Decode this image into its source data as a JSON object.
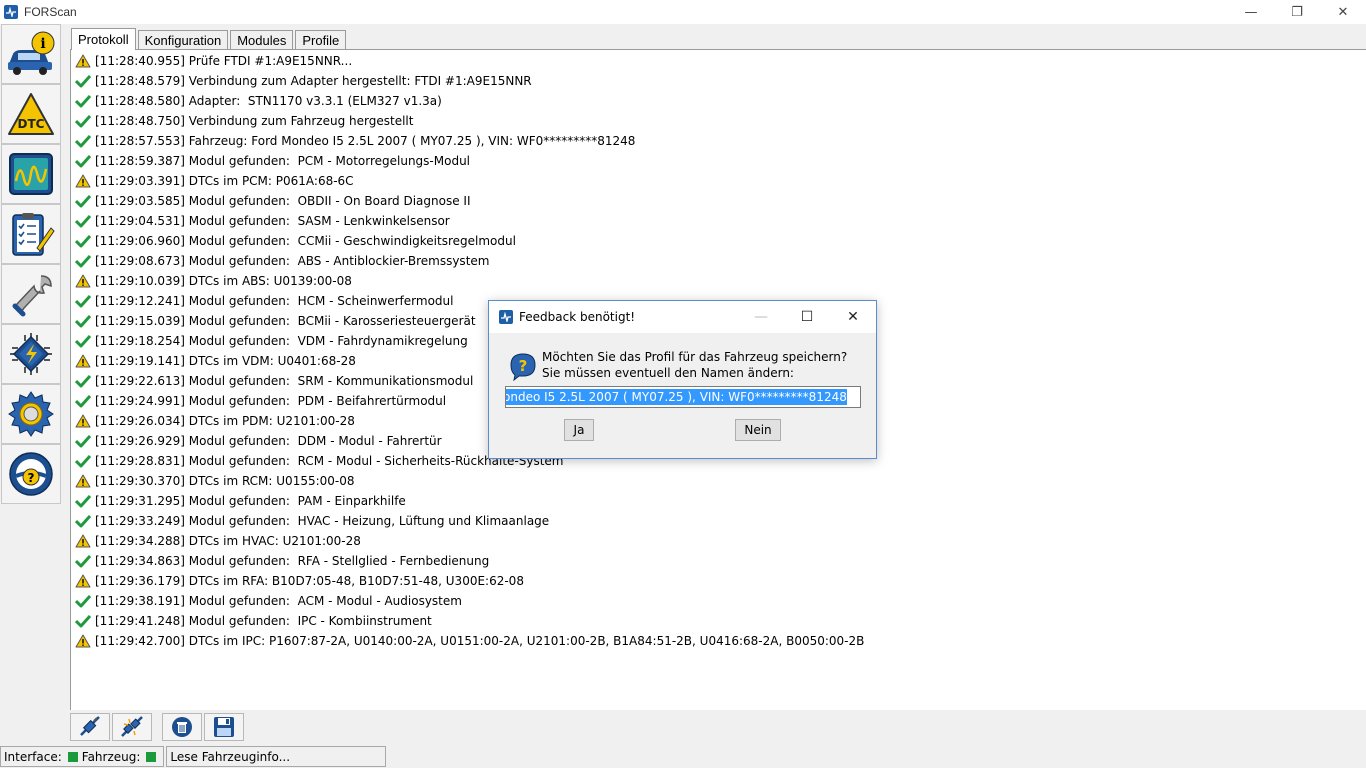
{
  "window": {
    "title": "FORScan",
    "minimize": "—",
    "restore": "❐",
    "close": "✕"
  },
  "sidebar": {
    "items": [
      {
        "name": "vehicle-info",
        "label": "i"
      },
      {
        "name": "dtc",
        "label": "DTC"
      },
      {
        "name": "oscilloscope",
        "label": ""
      },
      {
        "name": "tests-checklist",
        "label": ""
      },
      {
        "name": "service-wrench",
        "label": ""
      },
      {
        "name": "programming-chip",
        "label": ""
      },
      {
        "name": "settings-gear",
        "label": ""
      },
      {
        "name": "help",
        "label": "?"
      }
    ]
  },
  "tabs": [
    {
      "label": "Protokoll",
      "active": true
    },
    {
      "label": "Konfiguration",
      "active": false
    },
    {
      "label": "Modules",
      "active": false
    },
    {
      "label": "Profile",
      "active": false
    }
  ],
  "log": [
    {
      "status": "warning",
      "text": "[11:28:40.955] Prüfe FTDI #1:A9E15NNR..."
    },
    {
      "status": "ok",
      "text": "[11:28:48.579] Verbindung zum Adapter hergestellt: FTDI #1:A9E15NNR"
    },
    {
      "status": "ok",
      "text": "[11:28:48.580] Adapter:  STN1170 v3.3.1 (ELM327 v1.3a)"
    },
    {
      "status": "ok",
      "text": "[11:28:48.750] Verbindung zum Fahrzeug hergestellt"
    },
    {
      "status": "ok",
      "text": "[11:28:57.553] Fahrzeug: Ford Mondeo I5 2.5L 2007 ( MY07.25 ), VIN: WF0*********81248"
    },
    {
      "status": "ok",
      "text": "[11:28:59.387] Modul gefunden:  PCM - Motorregelungs-Modul"
    },
    {
      "status": "warning",
      "text": "[11:29:03.391] DTCs im PCM: P061A:68-6C"
    },
    {
      "status": "ok",
      "text": "[11:29:03.585] Modul gefunden:  OBDII - On Board Diagnose II"
    },
    {
      "status": "ok",
      "text": "[11:29:04.531] Modul gefunden:  SASM - Lenkwinkelsensor"
    },
    {
      "status": "ok",
      "text": "[11:29:06.960] Modul gefunden:  CCMii - Geschwindigkeitsregelmodul"
    },
    {
      "status": "ok",
      "text": "[11:29:08.673] Modul gefunden:  ABS - Antiblockier-Bremssystem"
    },
    {
      "status": "warning",
      "text": "[11:29:10.039] DTCs im ABS: U0139:00-08"
    },
    {
      "status": "ok",
      "text": "[11:29:12.241] Modul gefunden:  HCM - Scheinwerfermodul"
    },
    {
      "status": "ok",
      "text": "[11:29:15.039] Modul gefunden:  BCMii - Karosseriesteuergerät"
    },
    {
      "status": "ok",
      "text": "[11:29:18.254] Modul gefunden:  VDM - Fahrdynamikregelung"
    },
    {
      "status": "warning",
      "text": "[11:29:19.141] DTCs im VDM: U0401:68-28"
    },
    {
      "status": "ok",
      "text": "[11:29:22.613] Modul gefunden:  SRM - Kommunikationsmodul"
    },
    {
      "status": "ok",
      "text": "[11:29:24.991] Modul gefunden:  PDM - Beifahrertürmodul"
    },
    {
      "status": "warning",
      "text": "[11:29:26.034] DTCs im PDM: U2101:00-28"
    },
    {
      "status": "ok",
      "text": "[11:29:26.929] Modul gefunden:  DDM - Modul - Fahrertür"
    },
    {
      "status": "ok",
      "text": "[11:29:28.831] Modul gefunden:  RCM - Modul - Sicherheits-Rückhalte-System"
    },
    {
      "status": "warning",
      "text": "[11:29:30.370] DTCs im RCM: U0155:00-08"
    },
    {
      "status": "ok",
      "text": "[11:29:31.295] Modul gefunden:  PAM - Einparkhilfe"
    },
    {
      "status": "ok",
      "text": "[11:29:33.249] Modul gefunden:  HVAC - Heizung, Lüftung und Klimaanlage"
    },
    {
      "status": "warning",
      "text": "[11:29:34.288] DTCs im HVAC: U2101:00-28"
    },
    {
      "status": "ok",
      "text": "[11:29:34.863] Modul gefunden:  RFA - Stellglied - Fernbedienung"
    },
    {
      "status": "warning",
      "text": "[11:29:36.179] DTCs im RFA: B10D7:05-48, B10D7:51-48, U300E:62-08"
    },
    {
      "status": "ok",
      "text": "[11:29:38.191] Modul gefunden:  ACM - Modul - Audiosystem"
    },
    {
      "status": "ok",
      "text": "[11:29:41.248] Modul gefunden:  IPC - Kombiinstrument"
    },
    {
      "status": "warning",
      "text": "[11:29:42.700] DTCs im IPC: P1607:87-2A, U0140:00-2A, U0151:00-2A, U2101:00-2B, B1A84:51-2B, U0416:68-2A, B0050:00-2B"
    }
  ],
  "bottom_toolbar": {
    "buttons": [
      "connect-icon",
      "disconnect-icon",
      "clear-log-icon",
      "save-icon"
    ]
  },
  "statusbar": {
    "interface_label": "Interface:",
    "vehicle_label": "Fahrzeug:",
    "message": "Lese Fahrzeuginfo...",
    "led_color": "#1a9a3a"
  },
  "dialog": {
    "title": "Feedback benötigt!",
    "line1": "Möchten Sie das Profil für das Fahrzeug speichern?",
    "line2": "Sie müssen eventuell den Namen ändern:",
    "input_value": "ondeo I5 2.5L 2007 ( MY07.25 ), VIN: WF0*********81248",
    "yes_label": "Ja",
    "no_label": "Nein"
  },
  "colors": {
    "ok": "#1e9a3c",
    "warning": "#f5c400",
    "selection": "#3399ff",
    "dialog_border": "#5b8bd0"
  }
}
